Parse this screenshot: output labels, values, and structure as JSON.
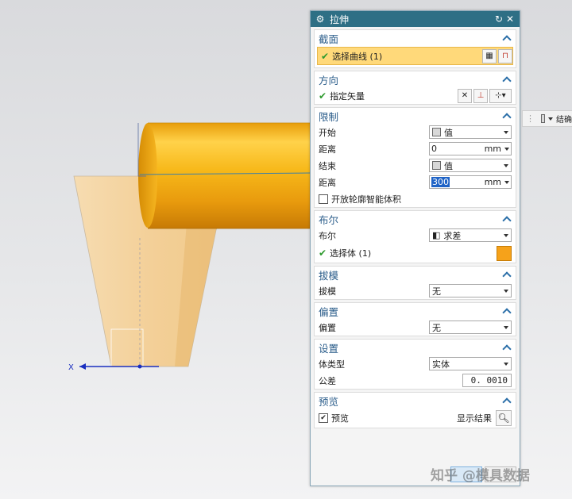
{
  "dialog": {
    "title": "拉伸",
    "sections": {
      "section": {
        "title": "截面",
        "select_curve": "选择曲线 (1)"
      },
      "direction": {
        "title": "方向",
        "vector": "指定矢量"
      },
      "limits": {
        "title": "限制",
        "start_label": "开始",
        "start_value": "值",
        "distance1_label": "距离",
        "distance1_value": "0",
        "distance1_unit": "mm",
        "end_label": "结束",
        "end_value": "值",
        "distance2_label": "距离",
        "distance2_value": "300",
        "distance2_unit": "mm",
        "open_profile": "开放轮廓智能体积"
      },
      "boolean": {
        "title": "布尔",
        "bool_label": "布尔",
        "bool_value": "求差",
        "select_body": "选择体 (1)"
      },
      "draft": {
        "title": "拔模",
        "label": "拔模",
        "value": "无"
      },
      "offset": {
        "title": "偏置",
        "label": "偏置",
        "value": "无"
      },
      "settings": {
        "title": "设置",
        "body_type_label": "体类型",
        "body_type_value": "实体",
        "tolerance_label": "公差",
        "tolerance_value": "0. 0010"
      },
      "preview": {
        "title": "预览",
        "preview_label": "预览",
        "show_result": "显示结果"
      }
    }
  },
  "side_toolbar": {
    "text": "结确"
  },
  "axis": {
    "x_label": "X"
  },
  "watermark": "知乎 @模具数据",
  "colors": {
    "titlebar": "#2e6f85",
    "select_highlight": "#ffd97a",
    "cylinder": "#f5b21c",
    "cone": "#f2d3a4"
  },
  "icons": [
    "gear-icon",
    "reset-icon",
    "close-icon",
    "chevron-up-icon",
    "curve-select-icon",
    "sketch-icon",
    "vector-icon",
    "cube-icon",
    "body-icon",
    "magnifier-icon"
  ]
}
